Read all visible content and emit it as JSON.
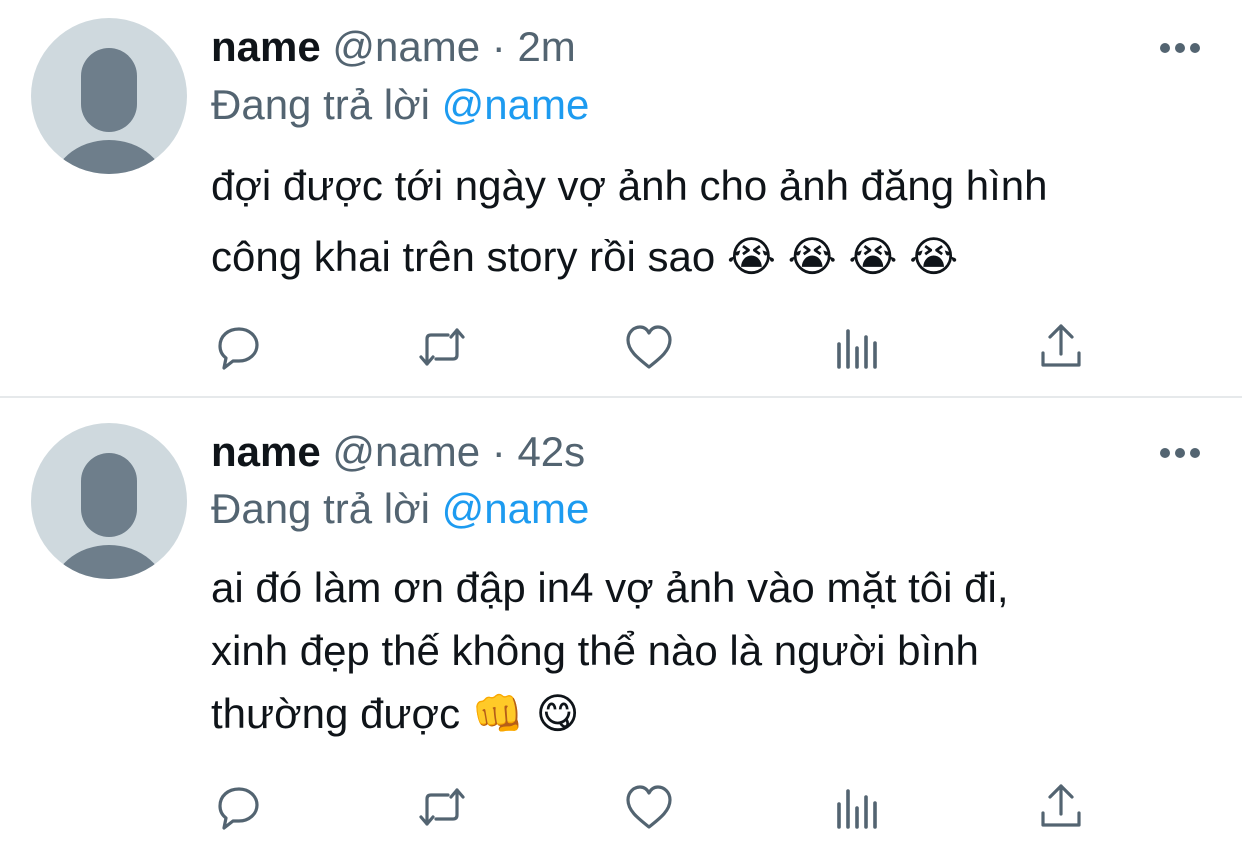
{
  "tweets": [
    {
      "name": "name",
      "handle": "@name",
      "separator": "·",
      "time": "2m",
      "reply_prefix": "Đang trả lời",
      "reply_mention": "@name",
      "lines": [
        "đợi được tới ngày vợ ảnh cho ảnh đăng hình",
        "công khai trên story rồi sao 😭 😭 😭 😭"
      ]
    },
    {
      "name": "name",
      "handle": "@name",
      "separator": "·",
      "time": "42s",
      "reply_prefix": "Đang trả lời",
      "reply_mention": "@name",
      "lines": [
        "ai đó làm ơn đập in4 vợ ảnh vào mặt tôi đi,",
        "xinh đẹp thế không thể nào là người bình",
        "thường được 👊 😋"
      ]
    }
  ],
  "icons": {
    "avatar": "default-avatar-icon",
    "more": "more-horizontal-icon",
    "reply": "reply-icon",
    "retweet": "retweet-icon",
    "like": "heart-icon",
    "views": "analytics-icon",
    "share": "share-icon"
  },
  "colors": {
    "text": "#0f1419",
    "secondary": "#536471",
    "mention": "#1d9bf0",
    "avatar_bg": "#cfd9de",
    "avatar_fg": "#6e7e8b",
    "divider": "#e6e9eb"
  }
}
